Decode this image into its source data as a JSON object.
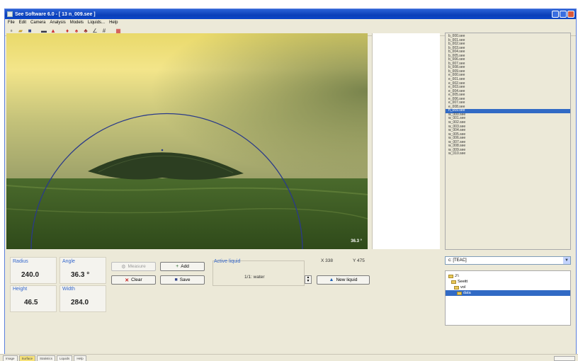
{
  "window": {
    "title": "See Software 6.0 - [ 13 n_009.see ]"
  },
  "menu": [
    "File",
    "Edit",
    "Camera",
    "Analysis",
    "Models",
    "Liquids...",
    "Help"
  ],
  "toolbar": {
    "icons": [
      "new-icon",
      "open-icon",
      "save-icon",
      "camera-icon",
      "drop-icon",
      "drop-left-icon",
      "drop-right-icon",
      "drops-icon",
      "angle-icon",
      "grid-icon",
      "report-icon"
    ]
  },
  "image": {
    "angle_label": "36.3 °"
  },
  "measure": {
    "radius_label": "Radius",
    "radius_value": "240.0",
    "angle_label": "Angle",
    "angle_value": "36.3 °",
    "height_label": "Height",
    "height_value": "46.5",
    "width_label": "Width",
    "width_value": "284.0"
  },
  "buttons": {
    "measure": "Measure",
    "add": "Add",
    "clear": "Clear",
    "save": "Save",
    "new_liquid": "New liquid"
  },
  "liquid": {
    "label": "Active liquid",
    "value": "1/1: water"
  },
  "coords": {
    "x": "X 338",
    "y": "Y 475"
  },
  "files": [
    "b_000.see",
    "b_001.see",
    "b_002.see",
    "b_003.see",
    "b_004.see",
    "b_005.see",
    "b_006.see",
    "b_007.see",
    "b_008.see",
    "b_009.see",
    "e_000.see",
    "e_001.see",
    "e_002.see",
    "e_003.see",
    "e_004.see",
    "e_005.see",
    "e_006.see",
    "e_007.see",
    "e_008.see",
    "n_009.see",
    "w_000.see",
    "w_001.see",
    "w_002.see",
    "w_003.see",
    "w_004.see",
    "w_005.see",
    "w_006.see",
    "w_007.see",
    "w_008.see",
    "w_009.see",
    "w_010.see"
  ],
  "selected_file_index": 19,
  "folder_combo": {
    "value": "c: [TEAC]"
  },
  "tree": [
    "J:\\",
    "Seeitt",
    "vol",
    "data"
  ],
  "statusbar_tabs": [
    "Image",
    "Surface",
    "Statistics",
    "Liquids",
    "Help"
  ],
  "colors": {
    "accent": "#316ac5",
    "sky_top": "#f3e27a",
    "water": "#3d5a25",
    "drop_outline": "#2a3a8a"
  }
}
